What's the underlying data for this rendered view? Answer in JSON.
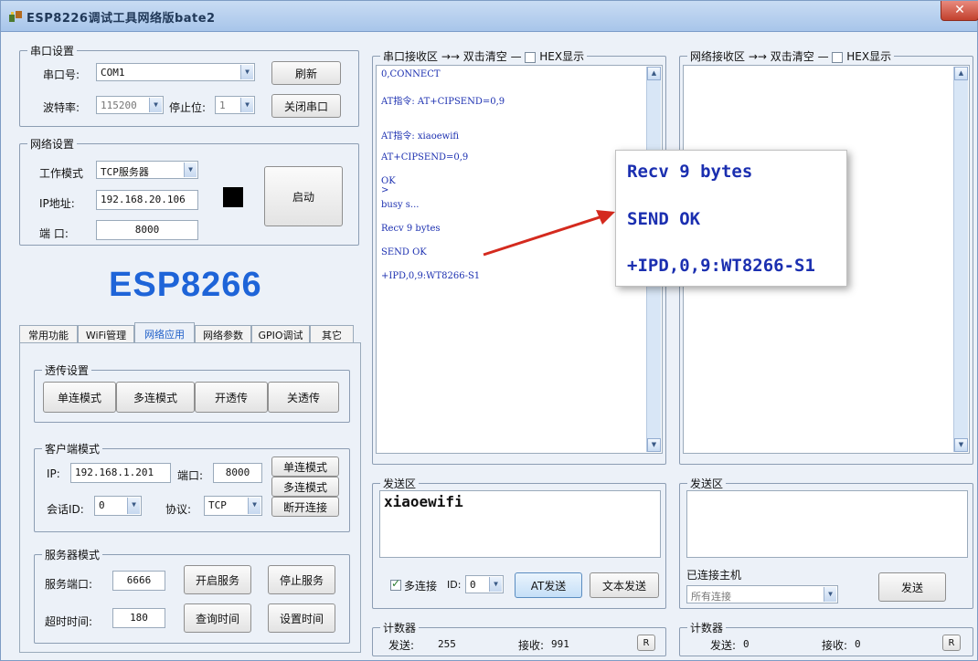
{
  "window": {
    "title": "ESP8226调试工具网络版bate2",
    "close_glyph": "✕"
  },
  "serial": {
    "group_label": "串口设置",
    "port_label": "串口号:",
    "port_value": "COM1",
    "refresh_button": "刷新",
    "baud_label": "波特率:",
    "baud_value": "115200",
    "stopbit_label": "停止位:",
    "stopbit_value": "1",
    "close_port_button": "关闭串口"
  },
  "network": {
    "group_label": "网络设置",
    "mode_label": "工作模式",
    "mode_value": "TCP服务器",
    "ip_label": "IP地址:",
    "ip_value": "192.168.20.106",
    "port_label": "端  口:",
    "port_value": "8000",
    "start_button": "启动"
  },
  "logo": "ESP8266",
  "tabs": [
    {
      "label": "常用功能",
      "active": false
    },
    {
      "label": "WiFi管理",
      "active": false
    },
    {
      "label": "网络应用",
      "active": true
    },
    {
      "label": "网络参数",
      "active": false
    },
    {
      "label": "GPIO调试",
      "active": false
    },
    {
      "label": "其它",
      "active": false
    }
  ],
  "passthrough": {
    "group_label": "透传设置",
    "buttons": [
      "单连模式",
      "多连模式",
      "开透传",
      "关透传"
    ]
  },
  "client": {
    "group_label": "客户端模式",
    "ip_label": "IP:",
    "ip_value": "192.168.1.201",
    "port_label": "端口:",
    "port_value": "8000",
    "single_button": "单连模式",
    "multi_button": "多连模式",
    "disconnect_button": "断开连接",
    "session_label": "会话ID:",
    "session_value": "0",
    "protocol_label": "协议:",
    "protocol_value": "TCP"
  },
  "server": {
    "group_label": "服务器模式",
    "port_label": "服务端口:",
    "port_value": "6666",
    "start_button": "开启服务",
    "stop_button": "停止服务",
    "timeout_label": "超时时间:",
    "timeout_value": "180",
    "query_button": "查询时间",
    "set_button": "设置时间"
  },
  "serial_recv": {
    "group_label": "串口接收区",
    "dblclick_hint": "双击清空",
    "hex_label": "HEX显示",
    "lines": [
      "0,CONNECT",
      "AT指令: AT+CIPSEND=0,9",
      "AT指令: xiaoewifi",
      "AT+CIPSEND=0,9",
      "OK",
      ">",
      "busy s...",
      "Recv 9 bytes",
      "SEND OK",
      "+IPD,0,9:WT8266-S1"
    ]
  },
  "net_recv": {
    "group_label": "网络接收区",
    "dblclick_hint": "双击清空",
    "hex_label": "HEX显示"
  },
  "serial_send": {
    "group_label": "发送区",
    "text": "xiaoewifi",
    "multi_label": "多连接",
    "multi_checked": true,
    "id_label": "ID:",
    "id_value": "0",
    "at_send_button": "AT发送",
    "text_send_button": "文本发送"
  },
  "net_send": {
    "group_label": "发送区",
    "text": "",
    "connected_label": "已连接主机",
    "host_value": "所有连接",
    "send_button": "发送"
  },
  "serial_counter": {
    "group_label": "计数器",
    "sent_label": "发送:",
    "sent_value": "255",
    "recv_label": "接收:",
    "recv_value": "991",
    "reset_button": "R"
  },
  "net_counter": {
    "group_label": "计数器",
    "sent_label": "发送:",
    "sent_value": "0",
    "recv_label": "接收:",
    "recv_value": "0",
    "reset_button": "R"
  },
  "callout": {
    "lines": [
      "Recv 9 bytes",
      "SEND OK",
      "+IPD,0,9:WT8266-S1"
    ]
  },
  "colors": {
    "accent": "#1e64d8",
    "recv_text": "#1b2fb0",
    "arrow": "#d42a1e",
    "indicator": "#000000"
  }
}
